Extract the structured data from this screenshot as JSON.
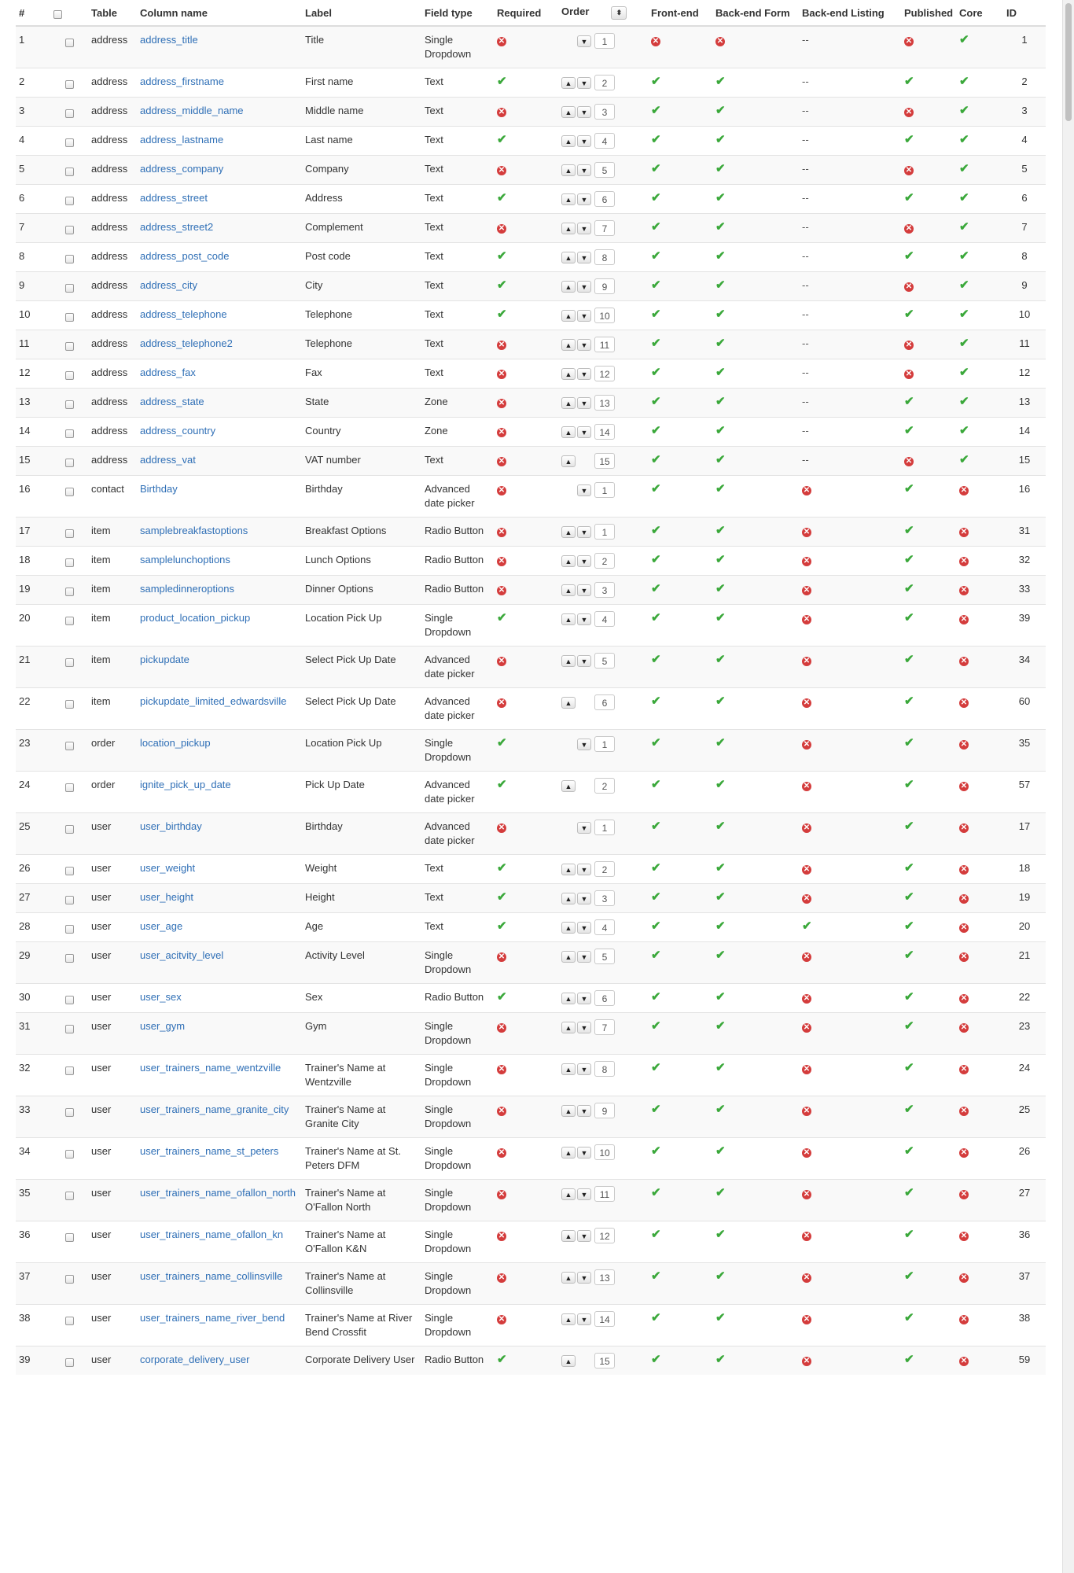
{
  "columns": {
    "num": "#",
    "table": "Table",
    "column_name": "Column name",
    "label": "Label",
    "field_type": "Field type",
    "required": "Required",
    "order": "Order",
    "frontend": "Front-end",
    "backend_form": "Back-end Form",
    "backend_listing": "Back-end Listing",
    "published": "Published",
    "core": "Core",
    "id": "ID"
  },
  "colors": {
    "link": "#2f6fb6",
    "check": "#3aa83a",
    "cross": "#d43c3c"
  },
  "icons": {
    "yes": "check-icon",
    "no": "cross-circle-icon",
    "up": "chevron-up-icon",
    "down": "chevron-down-icon"
  },
  "rows": [
    {
      "num": "1",
      "table": "address",
      "column_name": "address_title",
      "label": "Title",
      "type": "Single Dropdown",
      "required": "no",
      "up": false,
      "down": true,
      "order": "1",
      "front": "no",
      "bform": "no",
      "blist": "--",
      "published": "no",
      "core": "yes",
      "id": "1"
    },
    {
      "num": "2",
      "table": "address",
      "column_name": "address_firstname",
      "label": "First name",
      "type": "Text",
      "required": "yes",
      "up": true,
      "down": true,
      "order": "2",
      "front": "yes",
      "bform": "yes",
      "blist": "--",
      "published": "yes",
      "core": "yes",
      "id": "2"
    },
    {
      "num": "3",
      "table": "address",
      "column_name": "address_middle_name",
      "label": "Middle name",
      "type": "Text",
      "required": "no",
      "up": true,
      "down": true,
      "order": "3",
      "front": "yes",
      "bform": "yes",
      "blist": "--",
      "published": "no",
      "core": "yes",
      "id": "3"
    },
    {
      "num": "4",
      "table": "address",
      "column_name": "address_lastname",
      "label": "Last name",
      "type": "Text",
      "required": "yes",
      "up": true,
      "down": true,
      "order": "4",
      "front": "yes",
      "bform": "yes",
      "blist": "--",
      "published": "yes",
      "core": "yes",
      "id": "4"
    },
    {
      "num": "5",
      "table": "address",
      "column_name": "address_company",
      "label": "Company",
      "type": "Text",
      "required": "no",
      "up": true,
      "down": true,
      "order": "5",
      "front": "yes",
      "bform": "yes",
      "blist": "--",
      "published": "no",
      "core": "yes",
      "id": "5"
    },
    {
      "num": "6",
      "table": "address",
      "column_name": "address_street",
      "label": "Address",
      "type": "Text",
      "required": "yes",
      "up": true,
      "down": true,
      "order": "6",
      "front": "yes",
      "bform": "yes",
      "blist": "--",
      "published": "yes",
      "core": "yes",
      "id": "6"
    },
    {
      "num": "7",
      "table": "address",
      "column_name": "address_street2",
      "label": "Complement",
      "type": "Text",
      "required": "no",
      "up": true,
      "down": true,
      "order": "7",
      "front": "yes",
      "bform": "yes",
      "blist": "--",
      "published": "no",
      "core": "yes",
      "id": "7"
    },
    {
      "num": "8",
      "table": "address",
      "column_name": "address_post_code",
      "label": "Post code",
      "type": "Text",
      "required": "yes",
      "up": true,
      "down": true,
      "order": "8",
      "front": "yes",
      "bform": "yes",
      "blist": "--",
      "published": "yes",
      "core": "yes",
      "id": "8"
    },
    {
      "num": "9",
      "table": "address",
      "column_name": "address_city",
      "label": "City",
      "type": "Text",
      "required": "yes",
      "up": true,
      "down": true,
      "order": "9",
      "front": "yes",
      "bform": "yes",
      "blist": "--",
      "published": "no",
      "core": "yes",
      "id": "9"
    },
    {
      "num": "10",
      "table": "address",
      "column_name": "address_telephone",
      "label": "Telephone",
      "type": "Text",
      "required": "yes",
      "up": true,
      "down": true,
      "order": "10",
      "front": "yes",
      "bform": "yes",
      "blist": "--",
      "published": "yes",
      "core": "yes",
      "id": "10"
    },
    {
      "num": "11",
      "table": "address",
      "column_name": "address_telephone2",
      "label": "Telephone",
      "type": "Text",
      "required": "no",
      "up": true,
      "down": true,
      "order": "11",
      "front": "yes",
      "bform": "yes",
      "blist": "--",
      "published": "no",
      "core": "yes",
      "id": "11"
    },
    {
      "num": "12",
      "table": "address",
      "column_name": "address_fax",
      "label": "Fax",
      "type": "Text",
      "required": "no",
      "up": true,
      "down": true,
      "order": "12",
      "front": "yes",
      "bform": "yes",
      "blist": "--",
      "published": "no",
      "core": "yes",
      "id": "12"
    },
    {
      "num": "13",
      "table": "address",
      "column_name": "address_state",
      "label": "State",
      "type": "Zone",
      "required": "no",
      "up": true,
      "down": true,
      "order": "13",
      "front": "yes",
      "bform": "yes",
      "blist": "--",
      "published": "yes",
      "core": "yes",
      "id": "13"
    },
    {
      "num": "14",
      "table": "address",
      "column_name": "address_country",
      "label": "Country",
      "type": "Zone",
      "required": "no",
      "up": true,
      "down": true,
      "order": "14",
      "front": "yes",
      "bform": "yes",
      "blist": "--",
      "published": "yes",
      "core": "yes",
      "id": "14"
    },
    {
      "num": "15",
      "table": "address",
      "column_name": "address_vat",
      "label": "VAT number",
      "type": "Text",
      "required": "no",
      "up": true,
      "down": false,
      "order": "15",
      "front": "yes",
      "bform": "yes",
      "blist": "--",
      "published": "no",
      "core": "yes",
      "id": "15"
    },
    {
      "num": "16",
      "table": "contact",
      "column_name": "Birthday",
      "label": "Birthday",
      "type": "Advanced date picker",
      "required": "no",
      "up": false,
      "down": true,
      "order": "1",
      "front": "yes",
      "bform": "yes",
      "blist": "no",
      "published": "yes",
      "core": "no",
      "id": "16"
    },
    {
      "num": "17",
      "table": "item",
      "column_name": "samplebreakfastoptions",
      "label": "Breakfast Options",
      "type": "Radio Button",
      "required": "no",
      "up": true,
      "down": true,
      "order": "1",
      "front": "yes",
      "bform": "yes",
      "blist": "no",
      "published": "yes",
      "core": "no",
      "id": "31"
    },
    {
      "num": "18",
      "table": "item",
      "column_name": "samplelunchoptions",
      "label": "Lunch Options",
      "type": "Radio Button",
      "required": "no",
      "up": true,
      "down": true,
      "order": "2",
      "front": "yes",
      "bform": "yes",
      "blist": "no",
      "published": "yes",
      "core": "no",
      "id": "32"
    },
    {
      "num": "19",
      "table": "item",
      "column_name": "sampledinneroptions",
      "label": "Dinner Options",
      "type": "Radio Button",
      "required": "no",
      "up": true,
      "down": true,
      "order": "3",
      "front": "yes",
      "bform": "yes",
      "blist": "no",
      "published": "yes",
      "core": "no",
      "id": "33"
    },
    {
      "num": "20",
      "table": "item",
      "column_name": "product_location_pickup",
      "label": "Location Pick Up",
      "type": "Single Dropdown",
      "required": "yes",
      "up": true,
      "down": true,
      "order": "4",
      "front": "yes",
      "bform": "yes",
      "blist": "no",
      "published": "yes",
      "core": "no",
      "id": "39"
    },
    {
      "num": "21",
      "table": "item",
      "column_name": "pickupdate",
      "label": "Select Pick Up Date",
      "type": "Advanced date picker",
      "required": "no",
      "up": true,
      "down": true,
      "order": "5",
      "front": "yes",
      "bform": "yes",
      "blist": "no",
      "published": "yes",
      "core": "no",
      "id": "34"
    },
    {
      "num": "22",
      "table": "item",
      "column_name": "pickupdate_limited_edwardsville",
      "label": "Select Pick Up Date",
      "type": "Advanced date picker",
      "required": "no",
      "up": true,
      "down": false,
      "order": "6",
      "front": "yes",
      "bform": "yes",
      "blist": "no",
      "published": "yes",
      "core": "no",
      "id": "60"
    },
    {
      "num": "23",
      "table": "order",
      "column_name": "location_pickup",
      "label": "Location Pick Up",
      "type": "Single Dropdown",
      "required": "yes",
      "up": false,
      "down": true,
      "order": "1",
      "front": "yes",
      "bform": "yes",
      "blist": "no",
      "published": "yes",
      "core": "no",
      "id": "35"
    },
    {
      "num": "24",
      "table": "order",
      "column_name": "ignite_pick_up_date",
      "label": "Pick Up Date",
      "type": "Advanced date picker",
      "required": "yes",
      "up": true,
      "down": false,
      "order": "2",
      "front": "yes",
      "bform": "yes",
      "blist": "no",
      "published": "yes",
      "core": "no",
      "id": "57"
    },
    {
      "num": "25",
      "table": "user",
      "column_name": "user_birthday",
      "label": "Birthday",
      "type": "Advanced date picker",
      "required": "no",
      "up": false,
      "down": true,
      "order": "1",
      "front": "yes",
      "bform": "yes",
      "blist": "no",
      "published": "yes",
      "core": "no",
      "id": "17"
    },
    {
      "num": "26",
      "table": "user",
      "column_name": "user_weight",
      "label": "Weight",
      "type": "Text",
      "required": "yes",
      "up": true,
      "down": true,
      "order": "2",
      "front": "yes",
      "bform": "yes",
      "blist": "no",
      "published": "yes",
      "core": "no",
      "id": "18"
    },
    {
      "num": "27",
      "table": "user",
      "column_name": "user_height",
      "label": "Height",
      "type": "Text",
      "required": "yes",
      "up": true,
      "down": true,
      "order": "3",
      "front": "yes",
      "bform": "yes",
      "blist": "no",
      "published": "yes",
      "core": "no",
      "id": "19"
    },
    {
      "num": "28",
      "table": "user",
      "column_name": "user_age",
      "label": "Age",
      "type": "Text",
      "required": "yes",
      "up": true,
      "down": true,
      "order": "4",
      "front": "yes",
      "bform": "yes",
      "blist": "yes",
      "published": "yes",
      "core": "no",
      "id": "20"
    },
    {
      "num": "29",
      "table": "user",
      "column_name": "user_acitvity_level",
      "label": "Activity Level",
      "type": "Single Dropdown",
      "required": "no",
      "up": true,
      "down": true,
      "order": "5",
      "front": "yes",
      "bform": "yes",
      "blist": "no",
      "published": "yes",
      "core": "no",
      "id": "21"
    },
    {
      "num": "30",
      "table": "user",
      "column_name": "user_sex",
      "label": "Sex",
      "type": "Radio Button",
      "required": "yes",
      "up": true,
      "down": true,
      "order": "6",
      "front": "yes",
      "bform": "yes",
      "blist": "no",
      "published": "yes",
      "core": "no",
      "id": "22"
    },
    {
      "num": "31",
      "table": "user",
      "column_name": "user_gym",
      "label": "Gym",
      "type": "Single Dropdown",
      "required": "no",
      "up": true,
      "down": true,
      "order": "7",
      "front": "yes",
      "bform": "yes",
      "blist": "no",
      "published": "yes",
      "core": "no",
      "id": "23"
    },
    {
      "num": "32",
      "table": "user",
      "column_name": "user_trainers_name_wentzville",
      "label": "Trainer's Name at Wentzville",
      "type": "Single Dropdown",
      "required": "no",
      "up": true,
      "down": true,
      "order": "8",
      "front": "yes",
      "bform": "yes",
      "blist": "no",
      "published": "yes",
      "core": "no",
      "id": "24"
    },
    {
      "num": "33",
      "table": "user",
      "column_name": "user_trainers_name_granite_city",
      "label": "Trainer's Name at Granite City",
      "type": "Single Dropdown",
      "required": "no",
      "up": true,
      "down": true,
      "order": "9",
      "front": "yes",
      "bform": "yes",
      "blist": "no",
      "published": "yes",
      "core": "no",
      "id": "25"
    },
    {
      "num": "34",
      "table": "user",
      "column_name": "user_trainers_name_st_peters",
      "label": "Trainer's Name at St. Peters DFM",
      "type": "Single Dropdown",
      "required": "no",
      "up": true,
      "down": true,
      "order": "10",
      "front": "yes",
      "bform": "yes",
      "blist": "no",
      "published": "yes",
      "core": "no",
      "id": "26"
    },
    {
      "num": "35",
      "table": "user",
      "column_name": "user_trainers_name_ofallon_north",
      "label": "Trainer's Name at O'Fallon North",
      "type": "Single Dropdown",
      "required": "no",
      "up": true,
      "down": true,
      "order": "11",
      "front": "yes",
      "bform": "yes",
      "blist": "no",
      "published": "yes",
      "core": "no",
      "id": "27"
    },
    {
      "num": "36",
      "table": "user",
      "column_name": "user_trainers_name_ofallon_kn",
      "label": "Trainer's Name at O'Fallon K&N",
      "type": "Single Dropdown",
      "required": "no",
      "up": true,
      "down": true,
      "order": "12",
      "front": "yes",
      "bform": "yes",
      "blist": "no",
      "published": "yes",
      "core": "no",
      "id": "36"
    },
    {
      "num": "37",
      "table": "user",
      "column_name": "user_trainers_name_collinsville",
      "label": "Trainer's Name at Collinsville",
      "type": "Single Dropdown",
      "required": "no",
      "up": true,
      "down": true,
      "order": "13",
      "front": "yes",
      "bform": "yes",
      "blist": "no",
      "published": "yes",
      "core": "no",
      "id": "37"
    },
    {
      "num": "38",
      "table": "user",
      "column_name": "user_trainers_name_river_bend",
      "label": "Trainer's Name at River Bend Crossfit",
      "type": "Single Dropdown",
      "required": "no",
      "up": true,
      "down": true,
      "order": "14",
      "front": "yes",
      "bform": "yes",
      "blist": "no",
      "published": "yes",
      "core": "no",
      "id": "38"
    },
    {
      "num": "39",
      "table": "user",
      "column_name": "corporate_delivery_user",
      "label": "Corporate Delivery User",
      "type": "Radio Button",
      "required": "yes",
      "up": true,
      "down": false,
      "order": "15",
      "front": "yes",
      "bform": "yes",
      "blist": "no",
      "published": "yes",
      "core": "no",
      "id": "59"
    }
  ]
}
